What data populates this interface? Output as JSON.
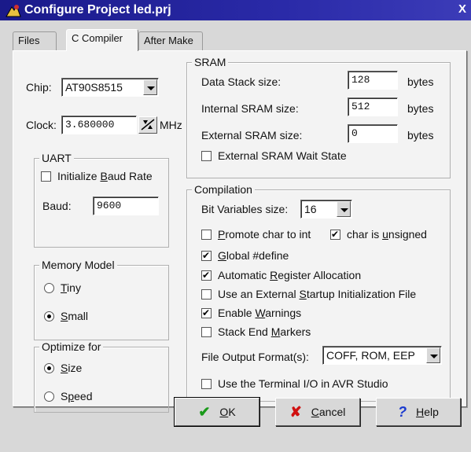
{
  "window": {
    "title": "Configure Project led.prj",
    "close_label": "X"
  },
  "tabs": [
    {
      "label": "Files",
      "active": false
    },
    {
      "label": "C Compiler",
      "active": true
    },
    {
      "label": "After Make",
      "active": false
    }
  ],
  "chip": {
    "label": "Chip:",
    "value": "AT90S8515"
  },
  "clock": {
    "label": "Clock:",
    "value": "3.680000",
    "unit": "MHz"
  },
  "uart": {
    "title": "UART",
    "init_baud": {
      "label_pre": "Initialize ",
      "label_key": "B",
      "label_post": "aud Rate",
      "checked": false
    },
    "baud_label": "Baud:",
    "baud_value": "9600"
  },
  "memory_model": {
    "title": "Memory Model",
    "tiny": {
      "label_key": "T",
      "label_post": "iny",
      "selected": false
    },
    "small": {
      "label_key": "S",
      "label_post": "mall",
      "selected": true
    }
  },
  "optimize": {
    "title": "Optimize for",
    "size": {
      "label_key": "S",
      "label_post": "ize",
      "selected": true
    },
    "speed": {
      "label_pre": "S",
      "label_key": "p",
      "label_post": "eed",
      "selected": false
    }
  },
  "sram": {
    "title": "SRAM",
    "data_stack": {
      "label": "Data Stack size:",
      "value": "128",
      "unit": "bytes"
    },
    "internal": {
      "label": "Internal SRAM size:",
      "value": "512",
      "unit": "bytes"
    },
    "external": {
      "label": "External SRAM size:",
      "value": "0",
      "unit": "bytes"
    },
    "wait_state": {
      "label": "External SRAM Wait State",
      "checked": false
    }
  },
  "compilation": {
    "title": "Compilation",
    "bit_vars": {
      "label": "Bit Variables size:",
      "value": "16"
    },
    "promote": {
      "label_key": "P",
      "label_post": "romote char to int",
      "checked": false
    },
    "unsigned": {
      "label_pre": "char is ",
      "label_key": "u",
      "label_post": "nsigned",
      "checked": true
    },
    "global_define": {
      "label_key": "G",
      "label_post": "lobal #define",
      "checked": true
    },
    "auto_reg": {
      "label_pre": "Automatic ",
      "label_key": "R",
      "label_post": "egister Allocation",
      "checked": true
    },
    "ext_startup": {
      "label_pre": "Use an External ",
      "label_key": "S",
      "label_post": "tartup Initialization File",
      "checked": false
    },
    "warnings": {
      "label_pre": "Enable ",
      "label_key": "W",
      "label_post": "arnings",
      "checked": true
    },
    "stack_end": {
      "label_pre": "Stack End ",
      "label_key": "M",
      "label_post": "arkers",
      "checked": false
    },
    "output_format": {
      "label": "File Output Format(s):",
      "value": "COFF, ROM, EEP"
    },
    "terminal_io": {
      "label": "Use the Terminal I/O in AVR Studio",
      "checked": false
    }
  },
  "buttons": {
    "ok": {
      "key": "O",
      "post": "K"
    },
    "cancel": {
      "key": "C",
      "post": "ancel"
    },
    "help": {
      "key": "H",
      "post": "elp"
    }
  },
  "colors": {
    "title_bar": "#1a1a8a",
    "ok_icon": "#1a9a1a",
    "cancel_icon": "#d01010",
    "help_icon": "#1a3ad0"
  }
}
